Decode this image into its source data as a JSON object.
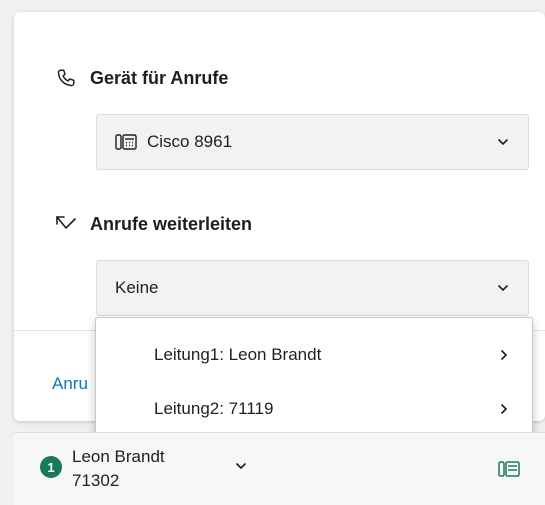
{
  "call_device": {
    "heading": "Gerät für Anrufe",
    "heading_icon": "phone-handset-icon",
    "selected_device": "Cisco 8961",
    "device_icon": "desk-phone-icon"
  },
  "forward_calls": {
    "heading": "Anrufe weiterleiten",
    "heading_icon": "call-forward-icon",
    "selected_value": "Keine",
    "options": [
      {
        "label": "Leitung1: Leon Brandt"
      },
      {
        "label": "Leitung2: 71119"
      }
    ]
  },
  "truncated_link": "Anru",
  "footer": {
    "line_number": "1",
    "user_name": "Leon Brandt",
    "extension": "71302",
    "status_icon": "desk-phone-icon"
  },
  "colors": {
    "accent_link": "#0a78b8",
    "badge_green": "#1b7a55"
  }
}
